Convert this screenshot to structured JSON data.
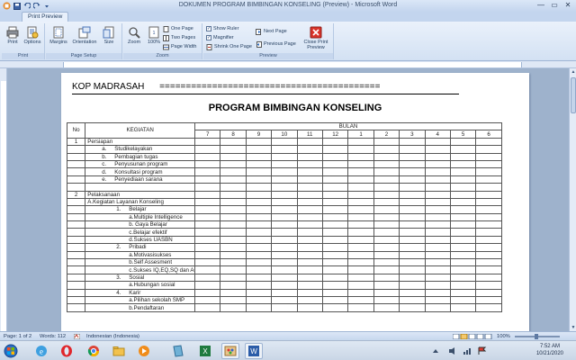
{
  "window": {
    "title": "DOKUMEN PROGRAM BIMBINGAN KONSELING (Preview) - Microsoft Word",
    "minimize": "—",
    "maximize": "▭",
    "close": "✕"
  },
  "ribbon": {
    "tab_label": "Print Preview",
    "groups": {
      "print": "Print",
      "page_setup": "Page Setup",
      "zoom": "Zoom",
      "preview": "Preview"
    },
    "buttons": {
      "print": "Print",
      "options": "Options",
      "margins": "Margins",
      "orientation": "Orientation",
      "size": "Size",
      "zoom": "Zoom",
      "hundred": "100%",
      "one_page": "One Page",
      "two_pages": "Two Pages",
      "page_width": "Page Width",
      "show_ruler": "Show Ruler",
      "magnifier": "Magnifier",
      "shrink_one_page": "Shrink One Page",
      "next_page": "Next Page",
      "previous_page": "Previous Page",
      "close_print_preview_1": "Close Print",
      "close_print_preview_2": "Preview"
    },
    "checks": {
      "show_ruler": true,
      "magnifier": true
    }
  },
  "document": {
    "kop": "KOP MADRASAH",
    "kop_rule": "==========================================",
    "title": "PROGRAM BIMBINGAN KONSELING",
    "headers": {
      "no": "No",
      "kegiatan": "KEGIATAN",
      "bulan": "BULAN",
      "months": [
        "7",
        "8",
        "9",
        "10",
        "11",
        "12",
        "1",
        "2",
        "3",
        "4",
        "5",
        "6"
      ]
    },
    "rows": [
      {
        "no": "1",
        "text": "Persiapan",
        "level": 0
      },
      {
        "no": "",
        "pre": "a.",
        "text": "Studikelayakan",
        "level": 1
      },
      {
        "no": "",
        "pre": "b.",
        "text": "Pembagian tugas",
        "level": 1
      },
      {
        "no": "",
        "pre": "c.",
        "text": "Penyusunan program",
        "level": 1
      },
      {
        "no": "",
        "pre": "d.",
        "text": "Konsultasi program",
        "level": 1
      },
      {
        "no": "",
        "pre": "e.",
        "text": "Penyediaan sarana",
        "level": 1
      },
      {
        "no": "",
        "text": "",
        "level": 0
      },
      {
        "no": "2",
        "text": "Pelaksanaan",
        "level": 0
      },
      {
        "no": "",
        "text": "A.Kegiatan Layanan Konseling",
        "level": 0
      },
      {
        "no": "",
        "pre": "1.",
        "text": "Belajar",
        "level": 2
      },
      {
        "no": "",
        "text": "a.Multiple Intelligence",
        "level": 3
      },
      {
        "no": "",
        "text": "b. Gaya Belajar",
        "level": 3
      },
      {
        "no": "",
        "text": "c.Belajar efektif",
        "level": 3
      },
      {
        "no": "",
        "text": "d.Sukses UASBN",
        "level": 3
      },
      {
        "no": "",
        "pre": "2.",
        "text": "Pribadi",
        "level": 2
      },
      {
        "no": "",
        "text": "a.Motivasisukses",
        "level": 3
      },
      {
        "no": "",
        "text": "b.Self Assesment",
        "level": 3
      },
      {
        "no": "",
        "text": "c.Sukses IQ,EQ,SQ dan AQ",
        "level": 3
      },
      {
        "no": "",
        "pre": "3.",
        "text": "Sosial",
        "level": 2
      },
      {
        "no": "",
        "text": "a.Hubungan sosial",
        "level": 3
      },
      {
        "no": "",
        "pre": "4.",
        "text": "Karir",
        "level": 2
      },
      {
        "no": "",
        "text": "a.Pilihan sekolah SMP",
        "level": 3
      },
      {
        "no": "",
        "text": "b.Pendaftaran",
        "level": 3
      }
    ]
  },
  "status": {
    "page": "Page: 1 of 2",
    "words": "Words: 112",
    "language": "Indonesian (Indonesia)",
    "zoom": "100%"
  },
  "taskbar": {
    "time": "7:52 AM",
    "date": "10/21/2020"
  }
}
